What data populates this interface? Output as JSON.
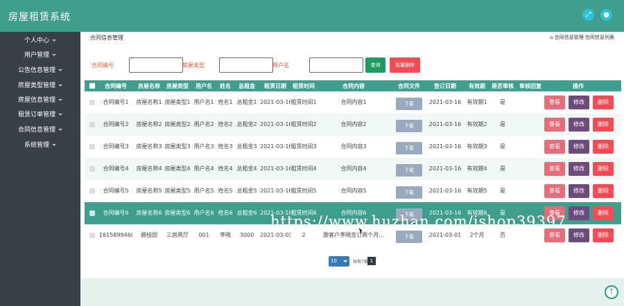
{
  "app": {
    "title": "房屋租赁系统"
  },
  "sidebar": {
    "items": [
      {
        "label": "个人中心"
      },
      {
        "label": "用户管理"
      },
      {
        "label": "公告信息管理"
      },
      {
        "label": "房屋类型管理"
      },
      {
        "label": "房屋信息管理"
      },
      {
        "label": "租赁订单管理"
      },
      {
        "label": "合同信息管理"
      },
      {
        "label": "系统管理"
      }
    ]
  },
  "page": {
    "title": "合同信息管理",
    "breadcrumb": "⌂ 合同信息管理 合同信息列表"
  },
  "search": {
    "label1": "合同编号",
    "label2": "房屋类型",
    "label3": "用户名",
    "search_btn": "查询",
    "batch_btn": "批量删除"
  },
  "table": {
    "headers": [
      "合同编号",
      "房屋名称",
      "房屋类型",
      "用户名",
      "姓名",
      "总租金",
      "租赁日期",
      "租赁时间",
      "合同内容",
      "合同文件",
      "签订日期",
      "有效期",
      "是否审核",
      "审核回复",
      "操作"
    ],
    "download_label": "下载",
    "actions": {
      "view": "查看",
      "edit": "修改",
      "delete": "删除"
    },
    "rows": [
      [
        "合同编号1",
        "房屋名称1",
        "房屋类型1",
        "用户名1",
        "姓名1",
        "总租金1",
        "2021-03-16",
        "租赁时间1",
        "合同内容1",
        "2021-03-16",
        "有效期1",
        "是",
        ""
      ],
      [
        "合同编号2",
        "房屋名称2",
        "房屋类型2",
        "用户名2",
        "姓名2",
        "总租金2",
        "2021-03-16",
        "租赁时间2",
        "合同内容2",
        "2021-03-16",
        "有效期2",
        "是",
        ""
      ],
      [
        "合同编号3",
        "房屋名称3",
        "房屋类型3",
        "用户名3",
        "姓名3",
        "总租金3",
        "2021-03-16",
        "租赁时间3",
        "合同内容3",
        "2021-03-16",
        "有效期3",
        "是",
        ""
      ],
      [
        "合同编号4",
        "房屋名称4",
        "房屋类型4",
        "用户名4",
        "姓名4",
        "总租金4",
        "2021-03-16",
        "租赁时间4",
        "合同内容4",
        "2021-03-16",
        "有效期4",
        "是",
        ""
      ],
      [
        "合同编号5",
        "房屋名称5",
        "房屋类型5",
        "用户名5",
        "姓名5",
        "总租金5",
        "2021-03-16",
        "租赁时间5",
        "合同内容5",
        "2021-03-16",
        "有效期5",
        "是",
        ""
      ],
      [
        "合同编号6",
        "房屋名称6",
        "房屋类型6",
        "用户名6",
        "姓名6",
        "总租金6",
        "2021-03-16",
        "租赁时间6",
        "合同内容6",
        "2021-03-16",
        "有效期6",
        "是",
        ""
      ],
      [
        "1615899460",
        "碧桂园",
        "三房两厅",
        "001",
        "李晓",
        "3000",
        "2021-03-01",
        "2",
        "跟客户李晓签订两个月...",
        "2021-03-01",
        "2个月",
        "否",
        ""
      ]
    ]
  },
  "pagination": {
    "page_size": "10",
    "total_label": "共有7条",
    "current": "1"
  },
  "watermark": "https://www.huzhan.com/ishop39397",
  "colors": {
    "header": "#3f9e8c",
    "sidebar": "#3a4046",
    "view": "#e86b78",
    "edit": "#6d4c7c",
    "delete": "#f44b54",
    "search": "#1f9c5e"
  },
  "icons": {
    "header_left": "scale-icon",
    "header_right": "user-icon",
    "back_to_top": "arrow-up-icon"
  }
}
